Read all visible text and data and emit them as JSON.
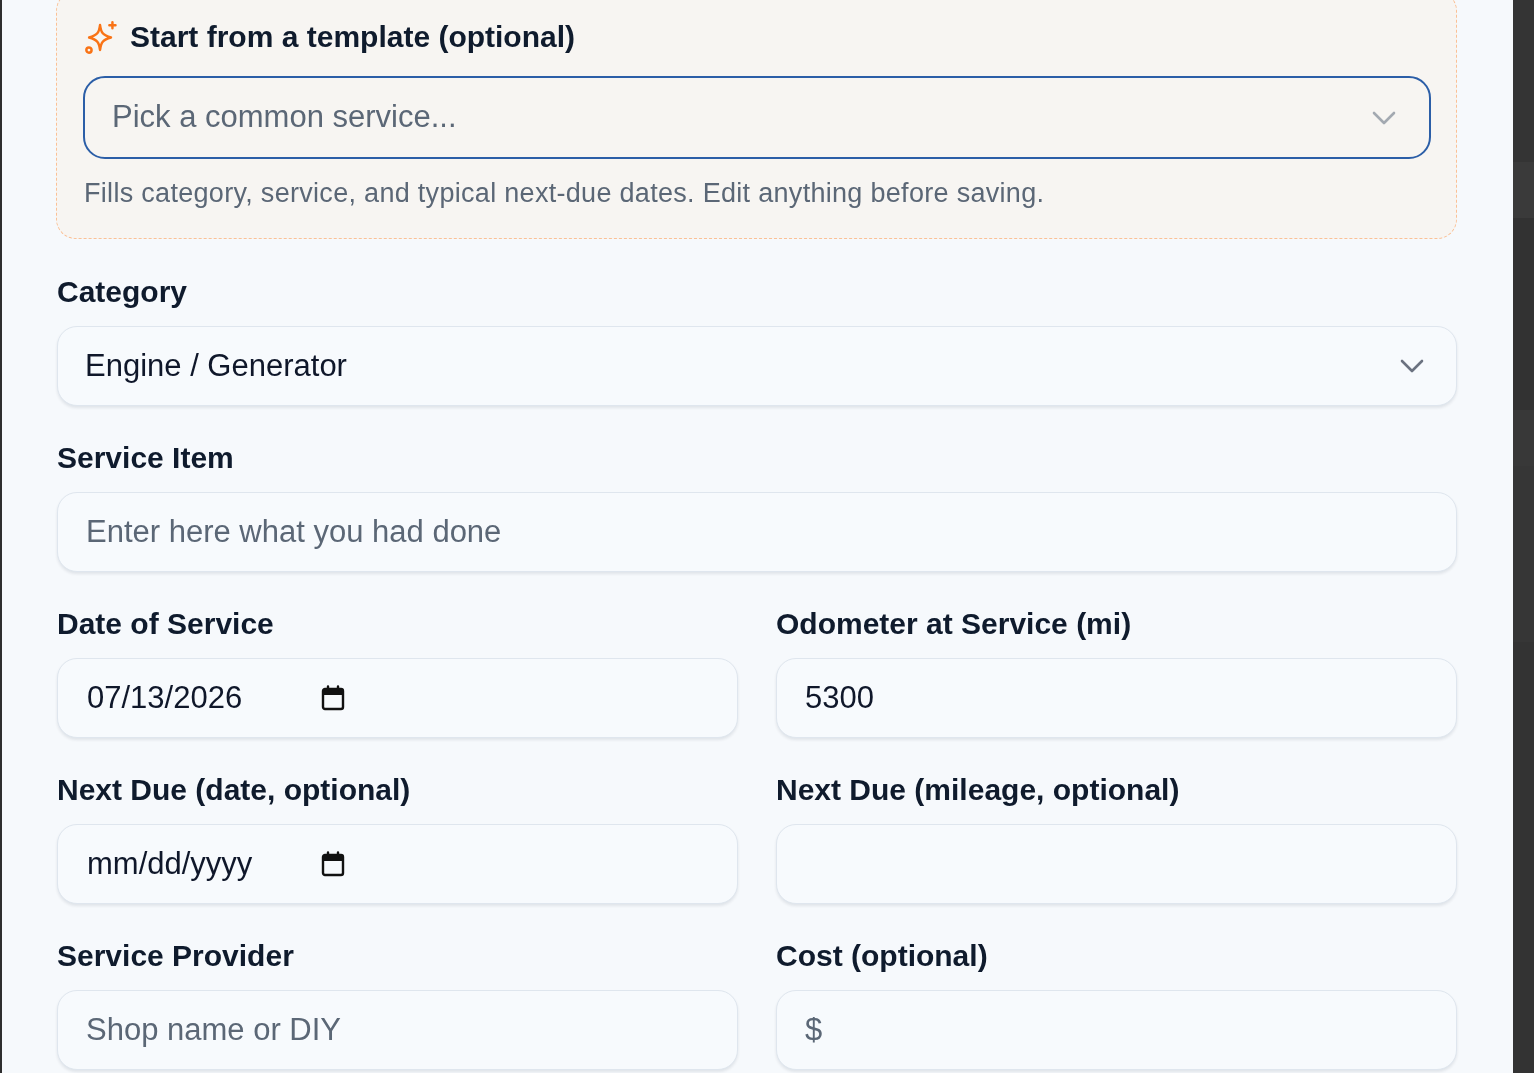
{
  "template": {
    "title": "Start from a template (optional)",
    "select": {
      "placeholder": "Pick a common service...",
      "focused": true
    },
    "help": "Fills category, service, and typical next-due dates. Edit anything before saving."
  },
  "rows": [
    {
      "fields": [
        {
          "label": "Category",
          "kind": "select",
          "value": "Engine / Generator"
        }
      ]
    },
    {
      "fields": [
        {
          "label": "Service Item",
          "kind": "text",
          "placeholder": "Enter here what you had done"
        }
      ]
    },
    {
      "fields": [
        {
          "label": "Date of Service",
          "kind": "date",
          "value": "07/13/2026"
        },
        {
          "label": "Odometer at Service (mi)",
          "kind": "text",
          "value": "5300"
        }
      ]
    },
    {
      "fields": [
        {
          "label": "Next Due (date, optional)",
          "kind": "date",
          "placeholder": "mm/dd/yyyy"
        },
        {
          "label": "Next Due (mileage, optional)",
          "kind": "text"
        }
      ]
    },
    {
      "fields": [
        {
          "label": "Service Provider",
          "kind": "text",
          "placeholder": "Shop name or DIY"
        },
        {
          "label": "Cost (optional)",
          "kind": "text",
          "placeholder": "$"
        }
      ]
    }
  ]
}
